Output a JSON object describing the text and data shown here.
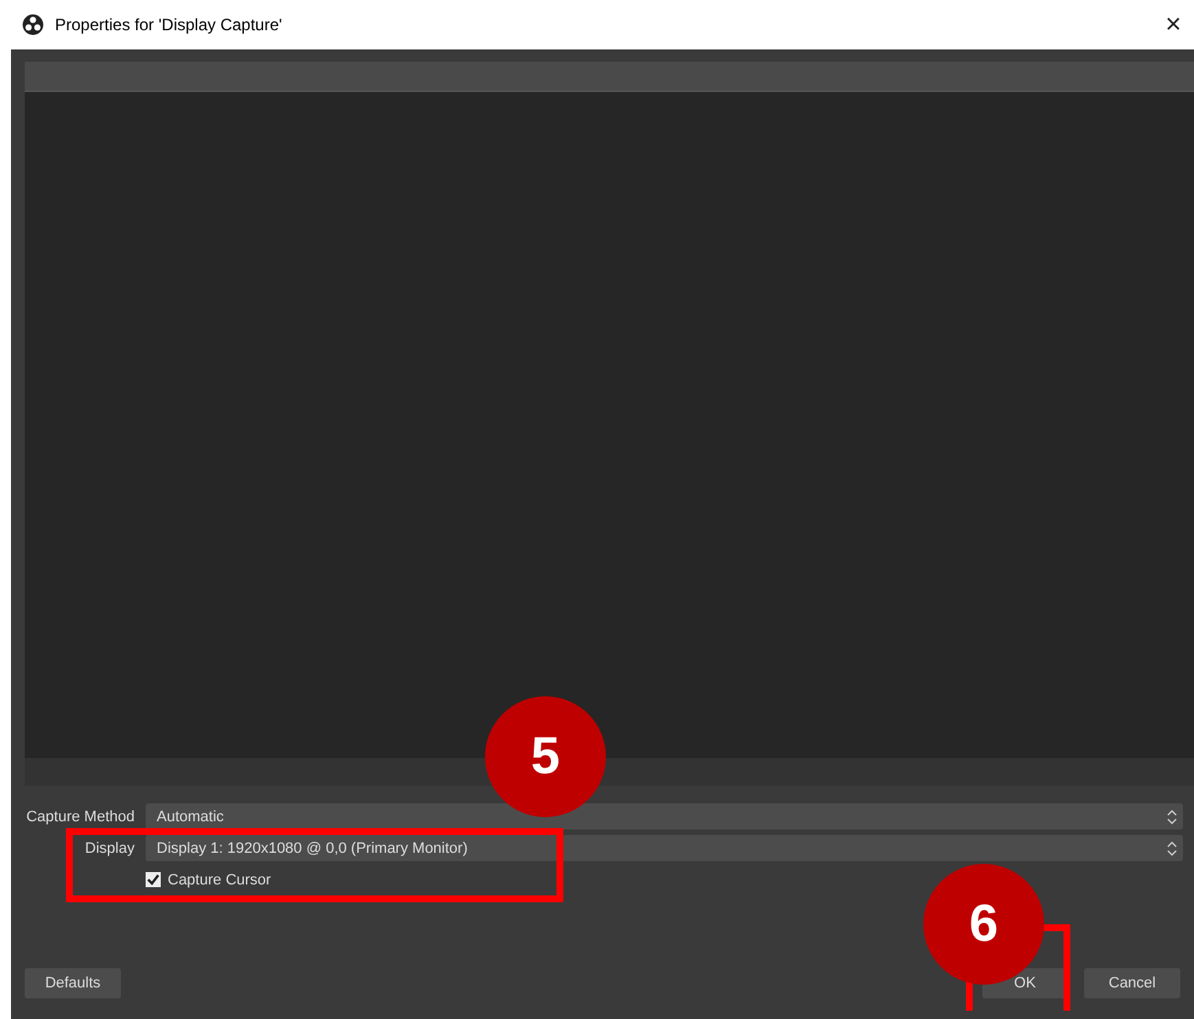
{
  "window": {
    "title": "Properties for 'Display Capture'",
    "close": "×"
  },
  "form": {
    "rows": [
      {
        "kind": "select",
        "label": "Capture Method",
        "value": "Automatic"
      },
      {
        "kind": "select",
        "label": "Display",
        "value": "Display 1: 1920x1080 @ 0,0 (Primary Monitor)"
      },
      {
        "kind": "checkbox",
        "label": "Capture Cursor",
        "checked": true
      }
    ]
  },
  "buttons": {
    "defaults": "Defaults",
    "ok": "OK",
    "cancel": "Cancel"
  },
  "annotations": [
    {
      "number": "5"
    },
    {
      "number": "6"
    }
  ]
}
